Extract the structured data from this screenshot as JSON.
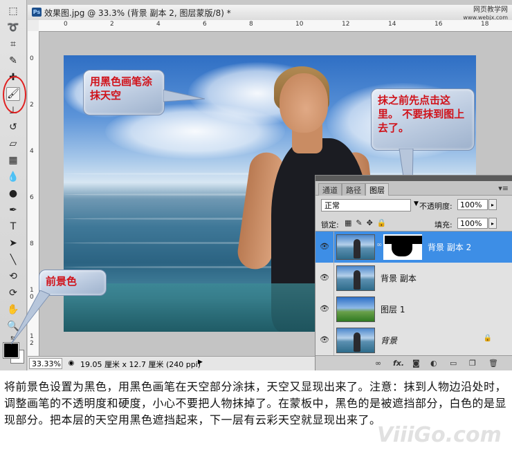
{
  "document": {
    "title": "效果图.jpg @ 33.3% (背景 副本 2, 图层蒙版/8) *",
    "ps_badge": "Ps",
    "site_watermark_line1": "网页教学网",
    "site_watermark_line2": "www.webjx.com"
  },
  "ruler_h_labels": [
    "0",
    "2",
    "4",
    "6",
    "8",
    "10",
    "12",
    "14",
    "16",
    "18"
  ],
  "ruler_v_labels": [
    "0",
    "2",
    "4",
    "6",
    "8",
    "1 0",
    "1 2"
  ],
  "callouts": {
    "brush": "用黑色画笔涂抹天空",
    "mask": "抹之前先点击这里。 不要抹到图上去了。",
    "foreground": "前景色"
  },
  "layers_panel": {
    "tabs": [
      "通道",
      "路径",
      "图层"
    ],
    "active_tab": "图层",
    "blend_mode": "正常",
    "opacity_label": "不透明度:",
    "opacity_value": "100%",
    "lock_label": "锁定:",
    "fill_label": "填充:",
    "fill_value": "100%",
    "layers": [
      {
        "name": "背景 副本 2",
        "selected": true,
        "has_mask": true
      },
      {
        "name": "背景 副本",
        "selected": false
      },
      {
        "name": "图层 1",
        "selected": false
      },
      {
        "name": "背景",
        "selected": false,
        "locked": true
      }
    ],
    "bottom_icons": [
      "link-icon",
      "fx-icon",
      "mask-icon",
      "adjustment-icon",
      "folder-icon",
      "new-layer-icon",
      "trash-icon"
    ],
    "fx_label": "fx."
  },
  "status": {
    "zoom": "33.33%",
    "doc_size": "19.05 厘米 x 12.7 厘米 (240 ppi)"
  },
  "caption": "将前景色设置为黑色，用黑色画笔在天空部分涂抹，天空又显现出来了。注意：抹到人物边沿处时，调整画笔的不透明度和硬度，小心不要把人物抹掉了。在蒙板中，黑色的是被遮挡部分，白色的是显现部分。把本层的天空用黑色遮挡起来，下一层有云彩天空就显现出来了。",
  "bottom_watermark": "ViiiGo.com"
}
